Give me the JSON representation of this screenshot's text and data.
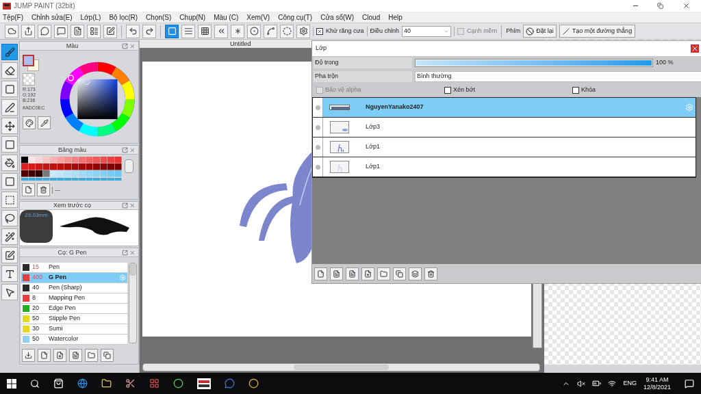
{
  "window": {
    "title": "JUMP PAINT (32bit)"
  },
  "menu": [
    "Tệp(F)",
    "Chỉnh sửa(E)",
    "Lớp(L)",
    "Bộ lọc(R)",
    "Chọn(S)",
    "Chụp(N)",
    "Màu (C)",
    "Xem(V)",
    "Công cụ(T)",
    "Cửa sổ(W)",
    "Cloud",
    "Help"
  ],
  "toolbar": {
    "ruler_buttons": [
      {
        "selected": true
      },
      {
        "selected": false
      },
      {
        "selected": false
      },
      {
        "selected": false
      },
      {
        "selected": false
      },
      {
        "selected": false
      },
      {
        "selected": false
      },
      {
        "selected": false
      },
      {
        "selected": false
      }
    ],
    "antialias": {
      "label": "Khử răng cưa",
      "checked": true
    },
    "adjust_label": "Điều chỉnh",
    "adjust_value": "40",
    "soft_edge": {
      "label": "Cạnh mềm",
      "checked": false,
      "disabled": true
    },
    "keys_label": "Phím",
    "reset_button": "Đặt lại",
    "line_button": "Tạo một đường thẳng"
  },
  "tools": [
    {
      "selected": true
    },
    {
      "selected": false
    },
    {
      "selected": false
    },
    {
      "selected": false
    },
    {
      "selected": false
    },
    {
      "selected": false
    },
    {
      "selected": false
    },
    {
      "selected": false
    },
    {
      "selected": false
    },
    {
      "selected": false
    },
    {
      "selected": false
    },
    {
      "selected": false
    },
    {
      "selected": false
    },
    {
      "selected": false
    }
  ],
  "color_panel": {
    "title": "Màu",
    "r": "R:173",
    "g": "G:192",
    "b": "B:236",
    "hex": "#ADC0EC"
  },
  "palette_panel": {
    "title": "Bảng màu",
    "set_name": "---"
  },
  "preview_panel": {
    "title": "Xem trước cọ",
    "size": "29.03mm"
  },
  "brush_panel": {
    "title": "Cọ: G Pen",
    "brushes": [
      {
        "size": "15",
        "name": "Pen",
        "color": "#2b2b2b",
        "selected": false,
        "marked": true
      },
      {
        "size": "400",
        "name": "G Pen",
        "color": "#e83b3b",
        "selected": true,
        "marked": true
      },
      {
        "size": "40",
        "name": "Pen (Sharp)",
        "color": "#2b2b2b",
        "selected": false,
        "marked": false
      },
      {
        "size": "8",
        "name": "Mapping Pen",
        "color": "#e83b3b",
        "selected": false,
        "marked": false
      },
      {
        "size": "20",
        "name": "Edge Pen",
        "color": "#22b022",
        "selected": false,
        "marked": false
      },
      {
        "size": "50",
        "name": "Stipple Pen",
        "color": "#e6d81e",
        "selected": false,
        "marked": false
      },
      {
        "size": "30",
        "name": "Sumi",
        "color": "#e6d81e",
        "selected": false,
        "marked": false
      },
      {
        "size": "50",
        "name": "Watercolor",
        "color": "#8fd3f4",
        "selected": false,
        "marked": false
      }
    ]
  },
  "canvas": {
    "tab": "Untitled"
  },
  "layers_panel": {
    "title": "Lớp",
    "opacity": {
      "label": "Độ trong",
      "level": 1.0,
      "reading": "100 %"
    },
    "blend": {
      "label": "Pha trộn",
      "value": "Bình thường"
    },
    "options": [
      {
        "label": "Bảo vệ alpha",
        "checked": false,
        "disabled": true
      },
      {
        "label": "Xén bớt",
        "checked": false,
        "disabled": false
      },
      {
        "label": "Khóa",
        "checked": false,
        "disabled": false
      }
    ],
    "layers": [
      {
        "name": "NguyenYanako2407",
        "selected": true,
        "kind": "text"
      },
      {
        "name": "Lớp3",
        "selected": false,
        "kind": "paint"
      },
      {
        "name": "Lớp1",
        "selected": false,
        "kind": "sketch"
      },
      {
        "name": "Lớp1",
        "selected": false,
        "kind": "faint"
      }
    ]
  },
  "taskbar": {
    "language": "ENG",
    "time": "9:41 AM",
    "date": "12/8/2021"
  }
}
